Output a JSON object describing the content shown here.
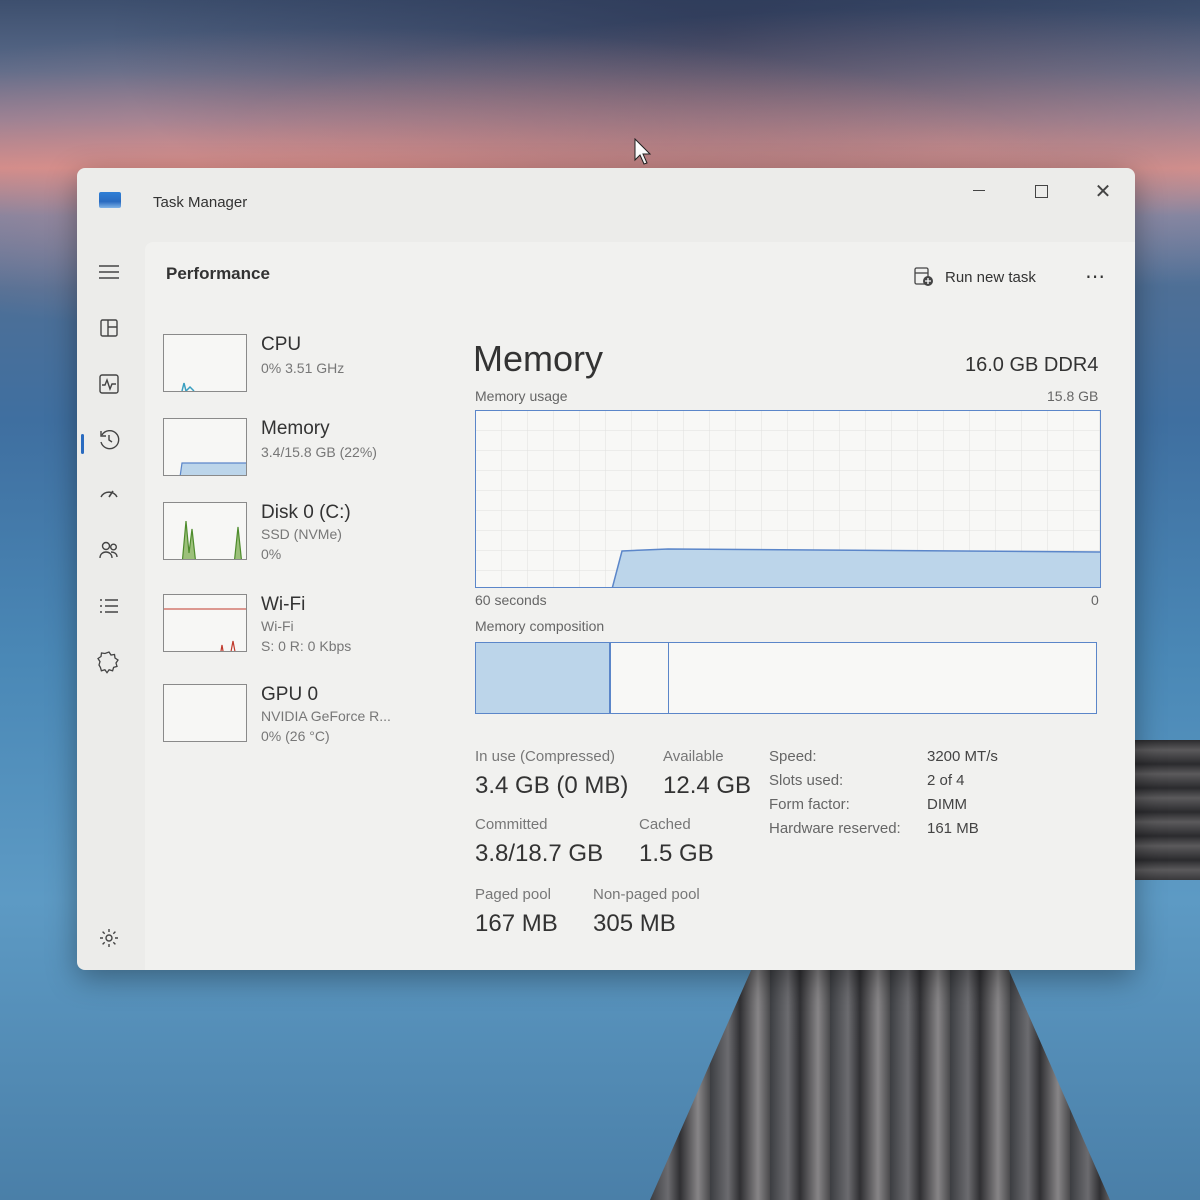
{
  "window": {
    "title": "Task Manager"
  },
  "header": {
    "page_title": "Performance",
    "run_new_task": "Run new task"
  },
  "sidebar": {
    "icons": [
      "hamburger-menu-icon",
      "processes-icon",
      "performance-icon",
      "app-history-icon",
      "startup-apps-icon",
      "users-icon",
      "details-icon",
      "services-icon",
      "settings-icon"
    ],
    "active": "performance-icon"
  },
  "devices": [
    {
      "name": "CPU",
      "line1": "0% 3.51 GHz",
      "line2": ""
    },
    {
      "name": "Memory",
      "line1": "3.4/15.8 GB (22%)",
      "line2": ""
    },
    {
      "name": "Disk 0 (C:)",
      "line1": "SSD (NVMe)",
      "line2": "0%"
    },
    {
      "name": "Wi-Fi",
      "line1": "Wi-Fi",
      "line2": "S: 0 R: 0 Kbps"
    },
    {
      "name": "GPU 0",
      "line1": "NVIDIA GeForce R...",
      "line2": "0% (26 °C)"
    }
  ],
  "memory": {
    "title": "Memory",
    "spec": "16.0 GB DDR4",
    "usage_label": "Memory usage",
    "usage_max": "15.8 GB",
    "time_left": "60 seconds",
    "time_right": "0",
    "composition_label": "Memory composition",
    "stats": {
      "in_use_label": "In use (Compressed)",
      "in_use_value": "3.4 GB (0 MB)",
      "available_label": "Available",
      "available_value": "12.4 GB",
      "committed_label": "Committed",
      "committed_value": "3.8/18.7 GB",
      "cached_label": "Cached",
      "cached_value": "1.5 GB",
      "paged_label": "Paged pool",
      "paged_value": "167 MB",
      "nonpaged_label": "Non-paged pool",
      "nonpaged_value": "305 MB"
    },
    "specs": {
      "speed_label": "Speed:",
      "speed_value": "3200 MT/s",
      "slots_label": "Slots used:",
      "slots_value": "2 of 4",
      "form_label": "Form factor:",
      "form_value": "DIMM",
      "hw_label": "Hardware reserved:",
      "hw_value": "161 MB"
    }
  },
  "colors": {
    "accent": "#2a6bc0",
    "graph_line": "#5b86c9",
    "graph_fill": "#bcd5ea",
    "disk_green": "#4e8c2c",
    "wifi_red": "#c0392b"
  }
}
